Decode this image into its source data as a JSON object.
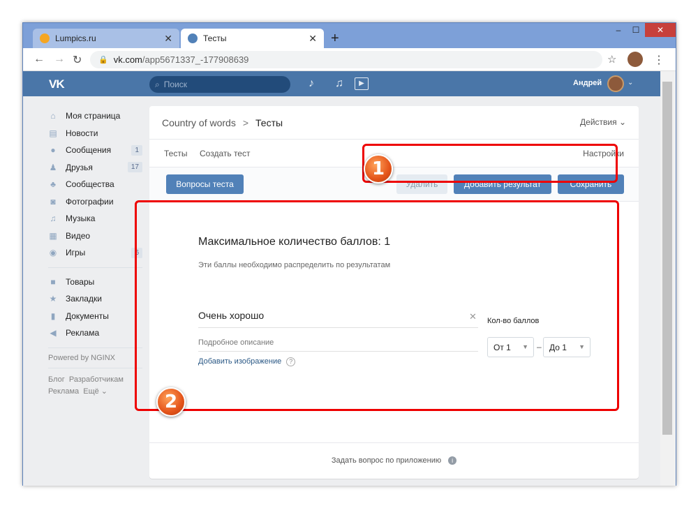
{
  "browser": {
    "tabs": [
      {
        "label": "Lumpics.ru",
        "favicon_color": "#f5a623"
      },
      {
        "label": "Тесты",
        "favicon_color": "#5181b8"
      }
    ],
    "new_tab": "+",
    "close_glyph": "✕",
    "url_domain": "vk.com",
    "url_path": "/app5671337_-177908639",
    "window_controls": [
      "–",
      "☐",
      "✕"
    ]
  },
  "vk_header": {
    "logo": "VK",
    "search_placeholder": "Поиск",
    "user_name": "Андрей"
  },
  "sidebar": {
    "items": [
      {
        "icon": "home-icon",
        "glyph": "⌂",
        "label": "Моя страница",
        "count": ""
      },
      {
        "icon": "news-icon",
        "glyph": "▤",
        "label": "Новости",
        "count": ""
      },
      {
        "icon": "messages-icon",
        "glyph": "●",
        "label": "Сообщения",
        "count": "1"
      },
      {
        "icon": "friends-icon",
        "glyph": "♟",
        "label": "Друзья",
        "count": "17"
      },
      {
        "icon": "groups-icon",
        "glyph": "♣",
        "label": "Сообщества",
        "count": ""
      },
      {
        "icon": "photos-icon",
        "glyph": "◙",
        "label": "Фотографии",
        "count": ""
      },
      {
        "icon": "music-icon",
        "glyph": "♫",
        "label": "Музыка",
        "count": ""
      },
      {
        "icon": "video-icon",
        "glyph": "▦",
        "label": "Видео",
        "count": ""
      },
      {
        "icon": "games-icon",
        "glyph": "◉",
        "label": "Игры",
        "count": "6"
      }
    ],
    "items2": [
      {
        "icon": "goods-icon",
        "glyph": "■",
        "label": "Товары"
      },
      {
        "icon": "bookmarks-icon",
        "glyph": "★",
        "label": "Закладки"
      },
      {
        "icon": "documents-icon",
        "glyph": "▮",
        "label": "Документы"
      },
      {
        "icon": "ads-icon",
        "glyph": "◀",
        "label": "Реклама"
      }
    ],
    "powered": "Powered by NGINX",
    "footer_links": [
      "Блог",
      "Разработчикам",
      "Реклама",
      "Ещё ⌄"
    ]
  },
  "card": {
    "breadcrumb_parent": "Country of words",
    "breadcrumb_sep": ">",
    "breadcrumb_current": "Тесты",
    "actions": "Действия ⌄",
    "tabs": [
      "Тесты",
      "Создать тест"
    ],
    "settings": "Настройки",
    "buttons": {
      "questions": "Вопросы теста",
      "delete": "Удалить",
      "add_result": "Добавить результат",
      "save": "Сохранить"
    },
    "max_score_title": "Максимальное количество баллов: 1",
    "max_score_hint": "Эти баллы необходимо распределить по результатам",
    "result_title_value": "Очень хорошо",
    "result_desc_placeholder": "Подробное описание",
    "add_image": "Добавить изображение",
    "help_glyph": "?",
    "score_label": "Кол-во баллов",
    "from_value": "От 1",
    "to_value": "До 1",
    "range_dash": "–",
    "footer_link": "Задать вопрос по приложению",
    "info_glyph": "i"
  },
  "annotations": {
    "badge1": "1",
    "badge2": "2"
  },
  "colors": {
    "vk_blue": "#4a76a8",
    "button_primary": "#5181b8",
    "highlight": "#e00000"
  }
}
